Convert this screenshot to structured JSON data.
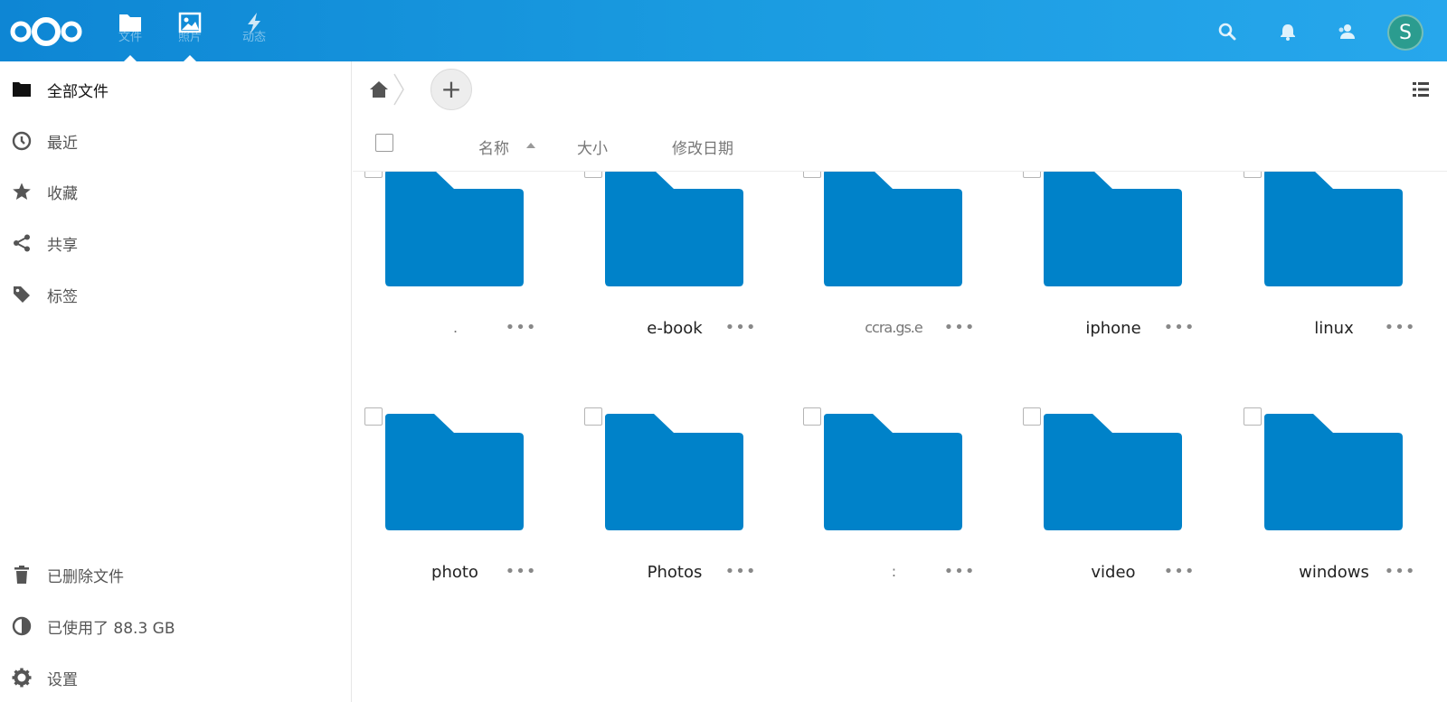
{
  "header": {
    "logo_icon": "nextcloud-logo-icon",
    "apps": [
      {
        "label": "文件",
        "icon": "folder-icon",
        "active": true
      },
      {
        "label": "照片",
        "icon": "image-icon",
        "active": false
      },
      {
        "label": "动态",
        "icon": "lightning-icon",
        "active": false
      }
    ],
    "right_icons": [
      "search-icon",
      "bell-icon",
      "contacts-icon"
    ],
    "avatar_initial": "S",
    "brand_color": "#1a9be0"
  },
  "sidebar": {
    "items": [
      {
        "label": "全部文件",
        "icon": "folder-icon",
        "active": true
      },
      {
        "label": "最近",
        "icon": "clock-icon"
      },
      {
        "label": "收藏",
        "icon": "star-icon"
      },
      {
        "label": "共享",
        "icon": "share-icon"
      },
      {
        "label": "标签",
        "icon": "tag-icon"
      }
    ],
    "bottom_items": [
      {
        "label": "已删除文件",
        "icon": "trash-icon"
      },
      {
        "label": "已使用了 88.3 GB",
        "icon": "pie-chart-icon"
      },
      {
        "label": "设置",
        "icon": "gear-icon"
      }
    ]
  },
  "controls": {
    "new_button_label": "+"
  },
  "table_header": {
    "name": "名称",
    "size": "大小",
    "modified": "修改日期"
  },
  "files": [
    {
      "name": ".",
      "type": "folder"
    },
    {
      "name": "e-book",
      "type": "folder"
    },
    {
      "name": "ccra.gs.e",
      "type": "folder"
    },
    {
      "name": "iphone",
      "type": "folder"
    },
    {
      "name": "linux",
      "type": "folder"
    },
    {
      "name": "photo",
      "type": "folder"
    },
    {
      "name": "Photos",
      "type": "folder"
    },
    {
      "name": ":",
      "type": "folder"
    },
    {
      "name": "video",
      "type": "folder"
    },
    {
      "name": "windows",
      "type": "folder"
    }
  ],
  "more_label": "•••",
  "folder_color": "#0082c9"
}
